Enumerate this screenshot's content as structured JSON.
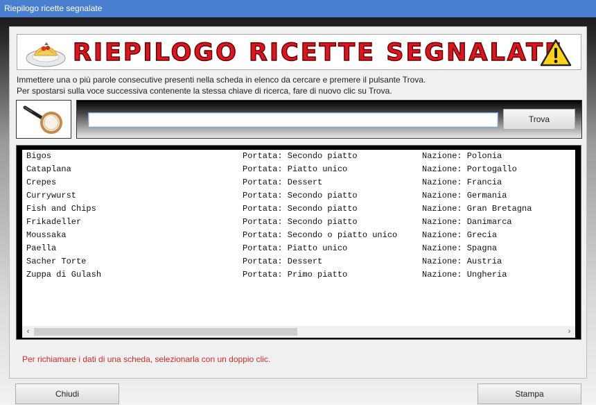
{
  "window": {
    "title": "Riepilogo ricette segnalate"
  },
  "banner": {
    "title": "RIEPILOGO RICETTE SEGNALATE",
    "left_icon": "pasta-plate-icon",
    "right_icon": "warning-icon"
  },
  "instructions": {
    "line1": "Immettere una o più parole consecutive presenti nella scheda in elenco da cercare e premere il pulsante Trova.",
    "line2": "Per spostarsi sulla voce successiva contenente la stessa chiave di ricerca, fare di nuovo clic su Trova."
  },
  "search": {
    "value": "",
    "placeholder": "",
    "button_label": "Trova",
    "icon": "magnifier-icon"
  },
  "list": {
    "rows": [
      {
        "name": "Bigos",
        "portata": "Portata: Secondo piatto",
        "nazione": "Nazione: Polonia"
      },
      {
        "name": "Cataplana",
        "portata": "Portata: Piatto unico",
        "nazione": "Nazione: Portogallo"
      },
      {
        "name": "Crepes",
        "portata": "Portata: Dessert",
        "nazione": "Nazione: Francia"
      },
      {
        "name": "Currywurst",
        "portata": "Portata: Secondo piatto",
        "nazione": "Nazione: Germania"
      },
      {
        "name": "Fish and Chips",
        "portata": "Portata: Secondo piatto",
        "nazione": "Nazione: Gran Bretagna"
      },
      {
        "name": "Frikadeller",
        "portata": "Portata: Secondo piatto",
        "nazione": "Nazione: Danimarca"
      },
      {
        "name": "Moussaka",
        "portata": "Portata: Secondo o piatto unico",
        "nazione": "Nazione: Grecia"
      },
      {
        "name": "Paella",
        "portata": "Portata: Piatto unico",
        "nazione": "Nazione: Spagna"
      },
      {
        "name": "Sacher Torte",
        "portata": "Portata: Dessert",
        "nazione": "Nazione: Austria"
      },
      {
        "name": "Zuppa di Gulash",
        "portata": "Portata: Primo piatto",
        "nazione": "Nazione: Ungheria"
      }
    ],
    "scroll_left": "‹",
    "scroll_right": "›"
  },
  "hint": "Per richiamare i dati di una scheda, selezionarla con un doppio clic.",
  "footer": {
    "close_label": "Chiudi",
    "print_label": "Stampa"
  },
  "colors": {
    "title_bar": "#4a7fd0",
    "banner_text": "#e0141e",
    "hint_text": "#d52a2a"
  }
}
